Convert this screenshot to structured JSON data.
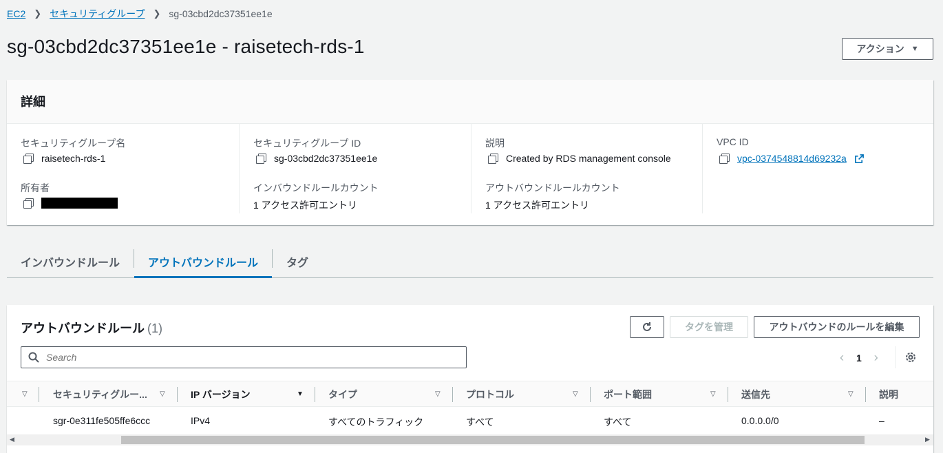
{
  "breadcrumb": {
    "root": "EC2",
    "parent": "セキュリティグループ",
    "current": "sg-03cbd2dc37351ee1e"
  },
  "page_title": "sg-03cbd2dc37351ee1e - raisetech-rds-1",
  "actions_button": "アクション",
  "details": {
    "heading": "詳細",
    "sg_name_label": "セキュリティグループ名",
    "sg_name_value": "raisetech-rds-1",
    "sg_id_label": "セキュリティグループ ID",
    "sg_id_value": "sg-03cbd2dc37351ee1e",
    "description_label": "説明",
    "description_value": "Created by RDS management console",
    "vpc_label": "VPC ID",
    "vpc_value": "vpc-0374548814d69232a",
    "owner_label": "所有者",
    "inbound_count_label": "インバウンドルールカウント",
    "inbound_count_value": "1 アクセス許可エントリ",
    "outbound_count_label": "アウトバウンドルールカウント",
    "outbound_count_value": "1 アクセス許可エントリ"
  },
  "tabs": [
    "インバウンドルール",
    "アウトバウンドルール",
    "タグ"
  ],
  "rules": {
    "title": "アウトバウンドルール",
    "count": "(1)",
    "manage_tags": "タグを管理",
    "edit_rules": "アウトバウンドのルールを編集",
    "search_placeholder": "Search",
    "page": "1",
    "columns": [
      "セキュリティグルー...",
      "IP バージョン",
      "タイプ",
      "プロトコル",
      "ポート範囲",
      "送信先",
      "説明"
    ],
    "rows": [
      {
        "rule_id": "sgr-0e311fe505ffe6ccc",
        "ip_version": "IPv4",
        "type": "すべてのトラフィック",
        "protocol": "すべて",
        "port_range": "すべて",
        "destination": "0.0.0.0/0",
        "description": "–"
      }
    ]
  }
}
